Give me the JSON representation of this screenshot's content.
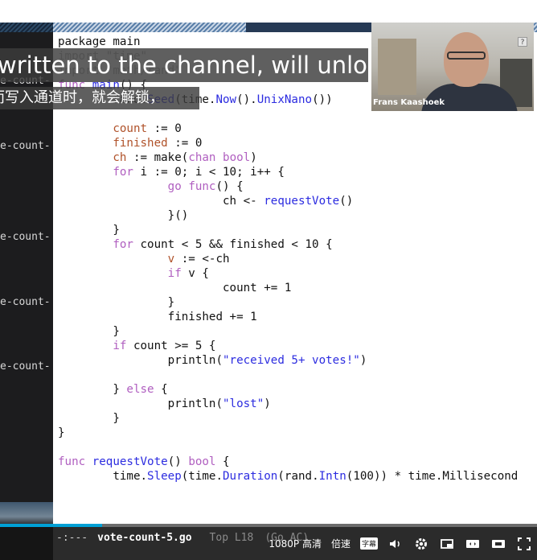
{
  "left_terminal": {
    "lines": [
      "e-count-",
      "e-count-",
      "e-count-",
      "e-count-",
      "e-count-"
    ],
    "bottom_char": ")"
  },
  "captions": {
    "english": "written to the channel, will unlock,",
    "chinese": "而写入通道时，就会解锁，"
  },
  "webcam": {
    "speaker_name": "Frans Kaashoek",
    "help_glyph": "?"
  },
  "editor": {
    "code_lines": [
      [
        {
          "t": "package main"
        }
      ],
      [
        {
          "t": "import \"time\"",
          "c": "dim"
        }
      ],
      [
        {
          "t": "import \"math/rand\"",
          "c": "dim"
        }
      ],
      [
        {
          "t": "func ",
          "c": "kw"
        },
        {
          "t": "main",
          "c": "fn"
        },
        {
          "t": "() {"
        }
      ],
      [
        {
          "t": "        rand."
        },
        {
          "t": "Seed",
          "c": "fn"
        },
        {
          "t": "(time."
        },
        {
          "t": "Now",
          "c": "fn"
        },
        {
          "t": "()."
        },
        {
          "t": "UnixNano",
          "c": "fn"
        },
        {
          "t": "())"
        }
      ],
      [
        {
          "t": ""
        }
      ],
      [
        {
          "t": "        "
        },
        {
          "t": "count",
          "c": "var"
        },
        {
          "t": " := 0"
        }
      ],
      [
        {
          "t": "        "
        },
        {
          "t": "finished",
          "c": "var"
        },
        {
          "t": " := 0"
        }
      ],
      [
        {
          "t": "        "
        },
        {
          "t": "ch",
          "c": "var"
        },
        {
          "t": " := make("
        },
        {
          "t": "chan",
          "c": "kw"
        },
        {
          "t": " "
        },
        {
          "t": "bool",
          "c": "kw"
        },
        {
          "t": ")"
        }
      ],
      [
        {
          "t": "        "
        },
        {
          "t": "for",
          "c": "kw"
        },
        {
          "t": " i := 0; i < 10; i++ {"
        }
      ],
      [
        {
          "t": "                "
        },
        {
          "t": "go",
          "c": "kw"
        },
        {
          "t": " "
        },
        {
          "t": "func",
          "c": "kw"
        },
        {
          "t": "() {"
        }
      ],
      [
        {
          "t": "                        ch <- "
        },
        {
          "t": "requestVote",
          "c": "fn"
        },
        {
          "t": "()"
        }
      ],
      [
        {
          "t": "                }()"
        }
      ],
      [
        {
          "t": "        }"
        }
      ],
      [
        {
          "t": "        "
        },
        {
          "t": "for",
          "c": "kw"
        },
        {
          "t": " count < 5 && finished < 10 {"
        }
      ],
      [
        {
          "t": "                "
        },
        {
          "t": "v",
          "c": "var"
        },
        {
          "t": " := <-ch"
        }
      ],
      [
        {
          "t": "                "
        },
        {
          "t": "if",
          "c": "kw"
        },
        {
          "t": " v {"
        }
      ],
      [
        {
          "t": "                        count += 1"
        }
      ],
      [
        {
          "t": "                }"
        }
      ],
      [
        {
          "t": "                finished += 1"
        }
      ],
      [
        {
          "t": "        }"
        }
      ],
      [
        {
          "t": "        "
        },
        {
          "t": "if",
          "c": "kw"
        },
        {
          "t": " count >= 5 {"
        }
      ],
      [
        {
          "t": "                println("
        },
        {
          "t": "\"received 5+ votes!\"",
          "c": "str"
        },
        {
          "t": ")"
        }
      ],
      [
        {
          "t": ""
        }
      ],
      [
        {
          "t": "        } "
        },
        {
          "t": "else",
          "c": "kw"
        },
        {
          "t": " {"
        }
      ],
      [
        {
          "t": "                println("
        },
        {
          "t": "\"lost\"",
          "c": "str"
        },
        {
          "t": ")"
        }
      ],
      [
        {
          "t": "        }"
        }
      ],
      [
        {
          "t": "}"
        }
      ],
      [
        {
          "t": ""
        }
      ],
      [
        {
          "t": "func ",
          "c": "kw"
        },
        {
          "t": "requestVote",
          "c": "fn"
        },
        {
          "t": "() "
        },
        {
          "t": "bool",
          "c": "kw"
        },
        {
          "t": " {"
        }
      ],
      [
        {
          "t": "        time."
        },
        {
          "t": "Sleep",
          "c": "fn"
        },
        {
          "t": "(time."
        },
        {
          "t": "Duration",
          "c": "fn"
        },
        {
          "t": "(rand."
        },
        {
          "t": "Intn",
          "c": "fn"
        },
        {
          "t": "(100)) * time.Millisecond"
        }
      ]
    ]
  },
  "modeline": {
    "prefix": "-:---",
    "filename": "vote-count-5.go",
    "position": "Top L18",
    "mode": "(Go AC)"
  },
  "player": {
    "progress_fraction": 0.19,
    "quality": "1080P 高清",
    "speed": "倍速",
    "subtitle_badge": "字幕",
    "icons": [
      "volume-icon",
      "settings-icon",
      "pip-icon",
      "widescreen-icon",
      "webfullscreen-icon",
      "fullscreen-icon"
    ]
  }
}
